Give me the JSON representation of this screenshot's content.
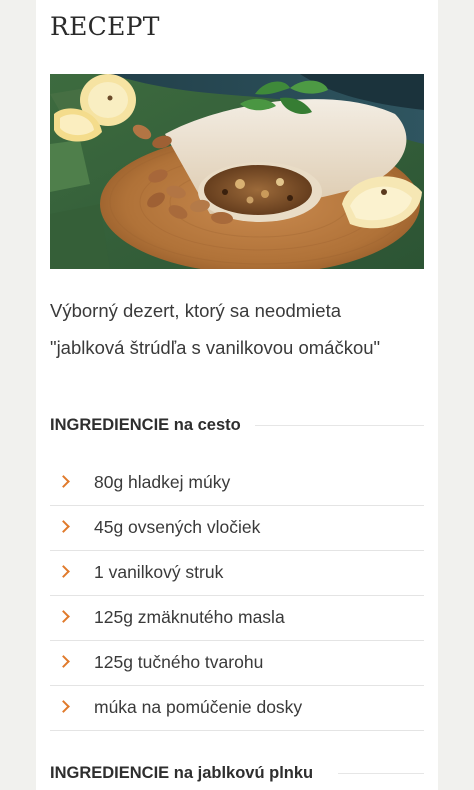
{
  "recipe": {
    "title": "RECEPT",
    "intro_line1": "Výborný dezert, ktorý sa neodmieta",
    "intro_line2": "\"jablková štrúdľa s vanilkovou omáčkou\""
  },
  "sections": {
    "dough": {
      "heading": "INGREDIENCIE na cesto",
      "items": [
        "80g hladkej múky",
        "45g ovsených vločiek",
        "1 vanilkový struk",
        "125g zmäknutého masla",
        "125g tučného tvarohu",
        "múka na pomúčenie dosky"
      ]
    },
    "filling": {
      "heading": "INGREDIENCIE na jablkovú plnku"
    }
  },
  "colors": {
    "accent": "#e07a2c",
    "page_background": "#f1f1ee"
  },
  "icons": {
    "list_bullet": "chevron-right-icon"
  }
}
